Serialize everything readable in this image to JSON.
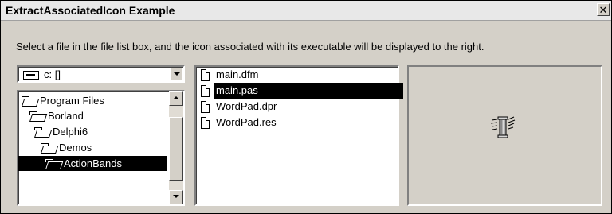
{
  "window": {
    "title": "ExtractAssociatedIcon Example",
    "close_label": "✕"
  },
  "instruction": "Select a file in the file list box, and the icon associated with its executable will be displayed to the right.",
  "drive_combo": {
    "value": "c: []",
    "icon": "drive-icon"
  },
  "directories": [
    {
      "label": "Program Files",
      "icon": "folder-open-icon",
      "selected": false
    },
    {
      "label": "Borland",
      "icon": "folder-open-icon",
      "selected": false
    },
    {
      "label": "Delphi6",
      "icon": "folder-open-icon",
      "selected": false
    },
    {
      "label": "Demos",
      "icon": "folder-open-icon",
      "selected": false
    },
    {
      "label": "ActionBands",
      "icon": "folder-open-icon",
      "selected": true
    }
  ],
  "files": [
    {
      "label": "main.dfm",
      "icon": "document-icon",
      "selected": false
    },
    {
      "label": "main.pas",
      "icon": "document-icon",
      "selected": true
    },
    {
      "label": "WordPad.dpr",
      "icon": "document-icon",
      "selected": false
    },
    {
      "label": "WordPad.res",
      "icon": "document-icon",
      "selected": false
    }
  ],
  "icon_display": {
    "icon": "delphi-column-icon"
  },
  "colors": {
    "face": "#d4d0c8",
    "selection": "#000000",
    "selection_text": "#ffffff"
  }
}
